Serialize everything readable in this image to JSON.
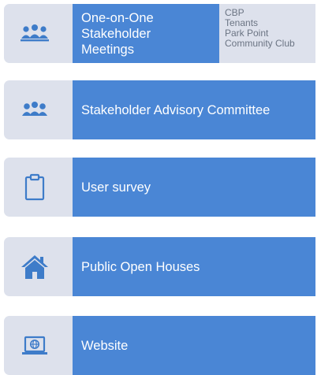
{
  "items": [
    {
      "label": "One-on-One\nStakeholder\nMeetings",
      "icon": "people-group-icon",
      "notes": [
        "CBP",
        "Tenants",
        "Park Point",
        "Community Club"
      ]
    },
    {
      "label": "Stakeholder Advisory Committee",
      "icon": "people-group-icon"
    },
    {
      "label": "User survey",
      "icon": "clipboard-icon"
    },
    {
      "label": "Public Open Houses",
      "icon": "house-icon"
    },
    {
      "label": "Website",
      "icon": "laptop-globe-icon"
    }
  ],
  "colors": {
    "bar": "#4a86d5",
    "tab": "#dde1ec",
    "icon": "#3e7cc9",
    "note_text": "#6b7483"
  }
}
